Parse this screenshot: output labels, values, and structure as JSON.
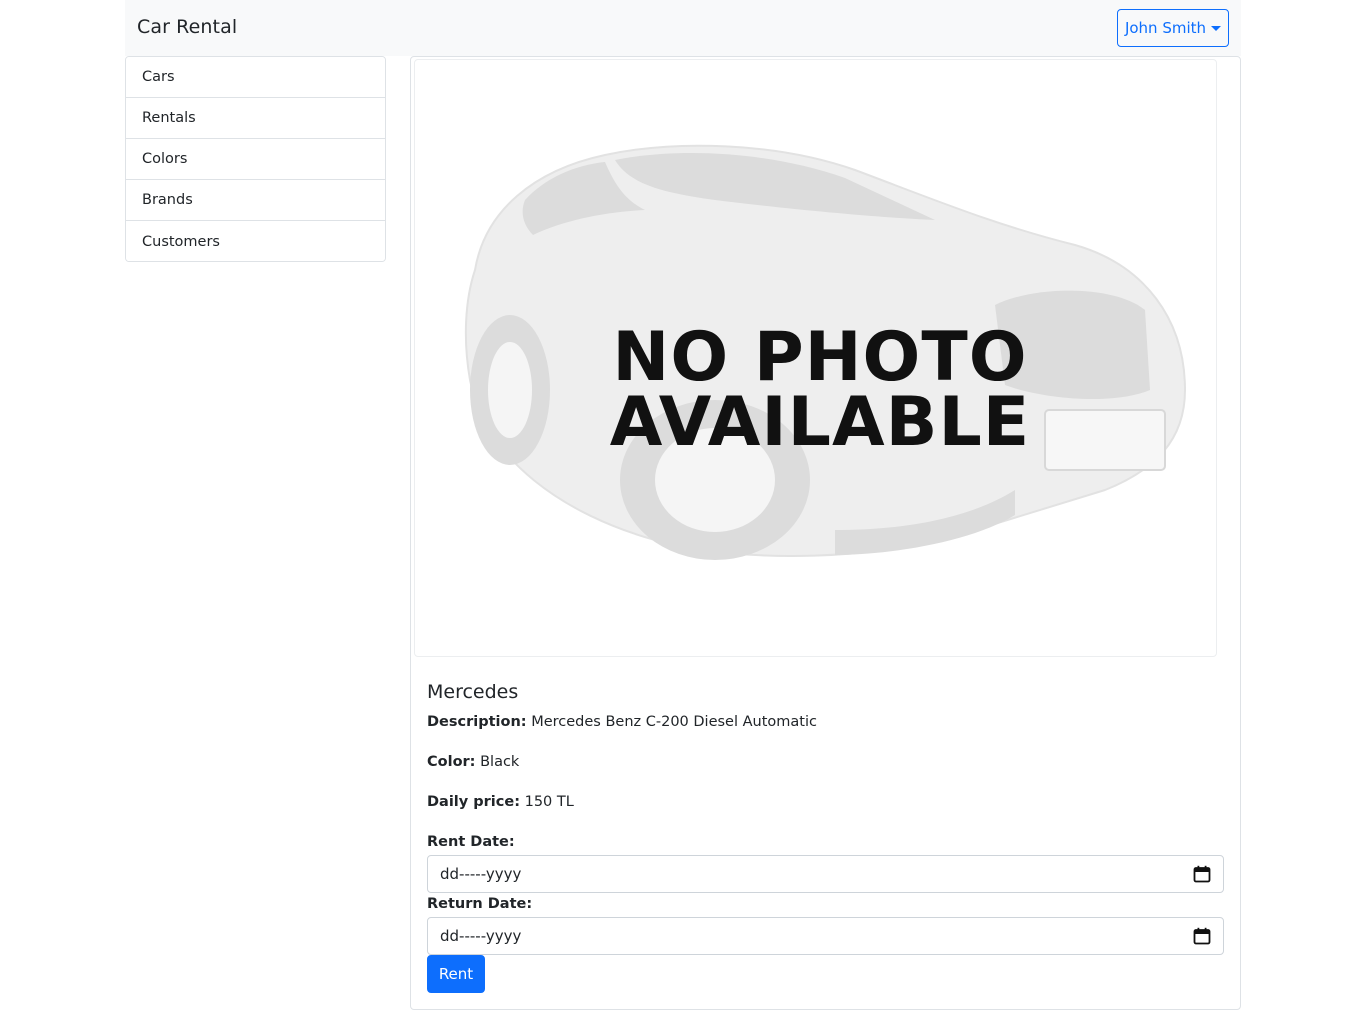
{
  "navbar": {
    "brand": "Car Rental",
    "user_menu_label": "John Smith"
  },
  "sidebar": {
    "items": [
      {
        "label": "Cars"
      },
      {
        "label": "Rentals"
      },
      {
        "label": "Colors"
      },
      {
        "label": "Brands"
      },
      {
        "label": "Customers"
      }
    ]
  },
  "car": {
    "image_text": [
      "NO PHOTO",
      "AVAILABLE"
    ],
    "brand": "Mercedes",
    "description_label": "Description:",
    "description": "Mercedes Benz C-200 Diesel Automatic",
    "color_label": "Color:",
    "color": "Black",
    "price_label": "Daily price:",
    "price": "150 TL"
  },
  "form": {
    "rent_date_label": "Rent Date:",
    "rent_date_placeholder": "dd-----yyyy",
    "return_date_label": "Return Date:",
    "return_date_placeholder": "dd-----yyyy",
    "submit_label": "Rent"
  },
  "colors": {
    "primary": "#0d6efd",
    "navbar_bg": "#f8f9fa",
    "border": "#dee2e6"
  }
}
